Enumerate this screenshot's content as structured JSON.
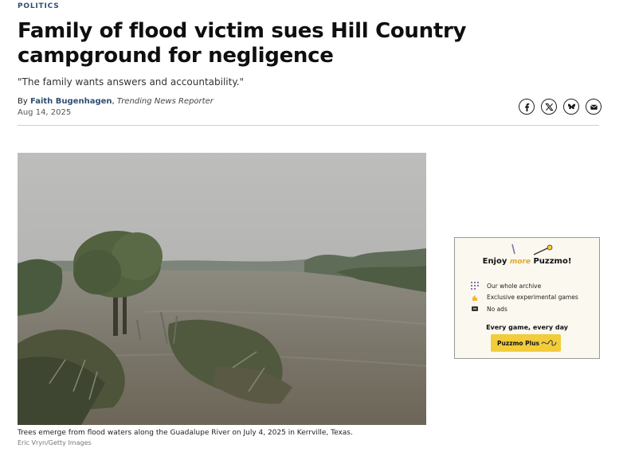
{
  "article": {
    "section": "POLITICS",
    "headline": "Family of flood victim sues Hill Country campground for negligence",
    "dek": "\"The family wants answers and accountability.\"",
    "byline_prefix": "By ",
    "author": "Faith Bugenhagen",
    "author_sep": ", ",
    "author_role": "Trending News Reporter",
    "date": "Aug 14, 2025"
  },
  "share": {
    "icons": [
      "facebook-icon",
      "x-icon",
      "bluesky-icon",
      "email-icon"
    ]
  },
  "hero": {
    "caption": "Trees emerge from flood waters along the Guadalupe River on July 4, 2025 in Kerrville, Texas.",
    "credit": "Eric Vryn/Getty Images"
  },
  "ad": {
    "title_pre": "Enjoy ",
    "title_more": "more",
    "title_post": " Puzzmo!",
    "features": [
      "Our whole archive",
      "Exclusive experimental games",
      "No ads"
    ],
    "tagline": "Every game, every day",
    "cta": "Puzzmo Plus",
    "accent": "#f2cc3a"
  },
  "colors": {
    "section": "#2f4f73",
    "divider": "#cfcfcf"
  }
}
